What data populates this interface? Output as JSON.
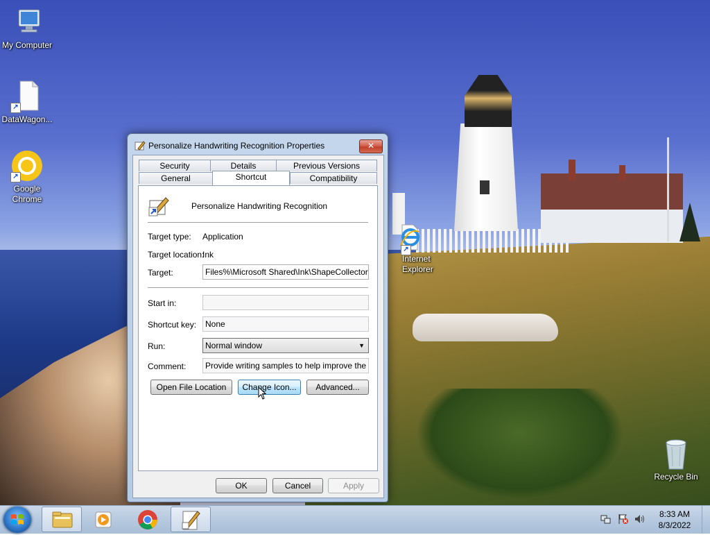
{
  "desktop": {
    "icons": [
      {
        "label": "My Computer"
      },
      {
        "label": "DataWagon..."
      },
      {
        "label": "Google Chrome"
      },
      {
        "label": "Internet Explorer"
      },
      {
        "label": "Recycle Bin"
      }
    ]
  },
  "dialog": {
    "title": "Personalize Handwriting Recognition Properties",
    "close_glyph": "✕",
    "tabs_row1": [
      "Security",
      "Details",
      "Previous Versions"
    ],
    "tabs_row2": [
      "General",
      "Shortcut",
      "Compatibility"
    ],
    "active_tab": "Shortcut",
    "shortcut_name": "Personalize Handwriting Recognition",
    "target_type": {
      "label": "Target type:",
      "value": "Application"
    },
    "target_location": {
      "label": "Target location:",
      "value": "Ink"
    },
    "target": {
      "label": "Target:",
      "value": "Files%\\Microsoft Shared\\Ink\\ShapeCollector.exe\""
    },
    "start_in": {
      "label": "Start in:",
      "value": ""
    },
    "shortcut_key": {
      "label": "Shortcut key:",
      "value": "None"
    },
    "run": {
      "label": "Run:",
      "value": "Normal window"
    },
    "comment": {
      "label": "Comment:",
      "value": "Provide writing samples to help improve the recogi"
    },
    "buttons": {
      "open_file_location": "Open File Location",
      "change_icon": "Change Icon...",
      "advanced": "Advanced...",
      "ok": "OK",
      "cancel": "Cancel",
      "apply": "Apply"
    }
  },
  "taskbar": {
    "time": "8:33 AM",
    "date": "8/3/2022"
  },
  "colors": {
    "accent": "#3c7fb1",
    "close_red": "#c2402b"
  }
}
